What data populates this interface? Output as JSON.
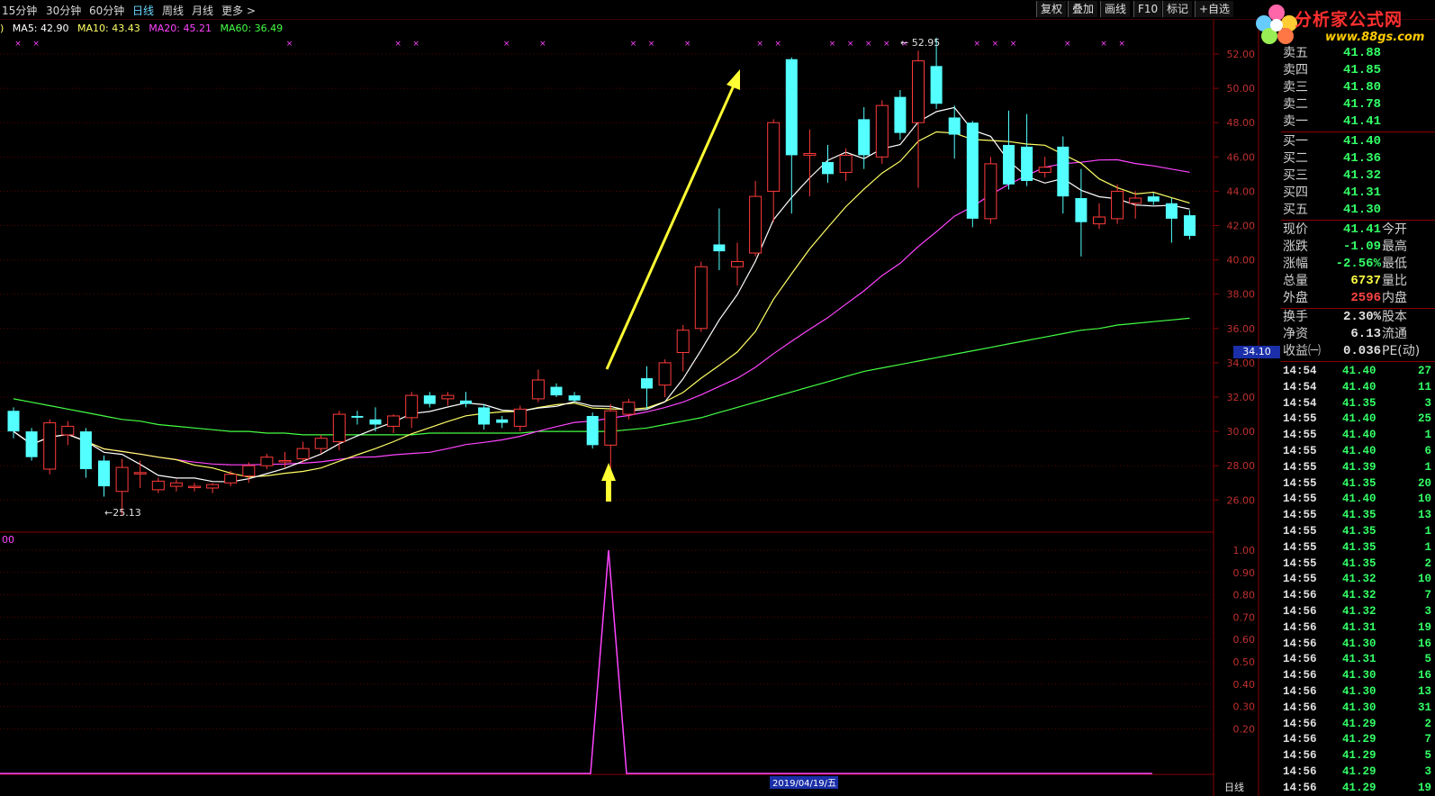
{
  "periods": [
    "15分钟",
    "30分钟",
    "60分钟",
    "日线",
    "周线",
    "月线",
    "更多 >"
  ],
  "active_period": "日线",
  "tools": [
    "复权",
    "叠加",
    "画线",
    "F10",
    "标记",
    "+自选"
  ],
  "logo": {
    "text": "分析家公式网",
    "url": "www.88gs.com"
  },
  "ma_legend": [
    {
      "label": "MA5: 42.90",
      "color": "#ffffff"
    },
    {
      "label": "MA10: 43.43",
      "color": "#ffff66"
    },
    {
      "label": "MA20: 45.21",
      "color": "#ff44ff"
    },
    {
      "label": "MA60: 36.49",
      "color": "#44ff44"
    }
  ],
  "price_axis": [
    "52.00",
    "50.00",
    "48.00",
    "46.00",
    "44.00",
    "42.00",
    "40.00",
    "38.00",
    "36.00",
    "34.00",
    "32.00",
    "30.00",
    "28.00",
    "26.00"
  ],
  "indicator_axis": [
    "1.00",
    "0.90",
    "0.80",
    "0.70",
    "0.60",
    "0.50",
    "0.40",
    "0.30",
    "0.20"
  ],
  "indicator_label": "00",
  "current_price_tag": "34.10",
  "high_label": "52.95",
  "low_label": "25.13",
  "bottom_date": "2019/04/19/五",
  "bottom_right_label": "日线",
  "quote": {
    "asks": [
      {
        "l": "卖五",
        "v": "41.88"
      },
      {
        "l": "卖四",
        "v": "41.85"
      },
      {
        "l": "卖三",
        "v": "41.80"
      },
      {
        "l": "卖二",
        "v": "41.78"
      },
      {
        "l": "卖一",
        "v": "41.41"
      }
    ],
    "bids": [
      {
        "l": "买一",
        "v": "41.40"
      },
      {
        "l": "买二",
        "v": "41.36"
      },
      {
        "l": "买三",
        "v": "41.32"
      },
      {
        "l": "买四",
        "v": "41.31"
      },
      {
        "l": "买五",
        "v": "41.30"
      }
    ],
    "stats": [
      {
        "l": "现价",
        "v": "41.41",
        "c": "#33ff66",
        "l2": "今开"
      },
      {
        "l": "涨跌",
        "v": "-1.09",
        "c": "#33ff66",
        "l2": "最高"
      },
      {
        "l": "涨幅",
        "v": "-2.56%",
        "c": "#33ff66",
        "l2": "最低"
      },
      {
        "l": "总量",
        "v": "6737",
        "c": "#ffff44",
        "l2": "量比"
      },
      {
        "l": "外盘",
        "v": "2596",
        "c": "#ff4444",
        "l2": "内盘"
      },
      {
        "l": "换手",
        "v": "2.30%",
        "c": "#e0e0e0",
        "l2": "股本"
      },
      {
        "l": "净资",
        "v": "6.13",
        "c": "#e0e0e0",
        "l2": "流通"
      },
      {
        "l": "收益㈠",
        "v": "0.036",
        "c": "#e0e0e0",
        "l2": "PE(动)"
      }
    ]
  },
  "ticks": [
    {
      "t": "14:54",
      "p": "41.40",
      "v": "27"
    },
    {
      "t": "14:54",
      "p": "41.40",
      "v": "11"
    },
    {
      "t": "14:54",
      "p": "41.35",
      "v": "3"
    },
    {
      "t": "14:55",
      "p": "41.40",
      "v": "25"
    },
    {
      "t": "14:55",
      "p": "41.40",
      "v": "1"
    },
    {
      "t": "14:55",
      "p": "41.40",
      "v": "6"
    },
    {
      "t": "14:55",
      "p": "41.39",
      "v": "1"
    },
    {
      "t": "14:55",
      "p": "41.35",
      "v": "20"
    },
    {
      "t": "14:55",
      "p": "41.40",
      "v": "10"
    },
    {
      "t": "14:55",
      "p": "41.35",
      "v": "13"
    },
    {
      "t": "14:55",
      "p": "41.35",
      "v": "1"
    },
    {
      "t": "14:55",
      "p": "41.35",
      "v": "1"
    },
    {
      "t": "14:55",
      "p": "41.35",
      "v": "2"
    },
    {
      "t": "14:55",
      "p": "41.32",
      "v": "10"
    },
    {
      "t": "14:56",
      "p": "41.32",
      "v": "7"
    },
    {
      "t": "14:56",
      "p": "41.32",
      "v": "3"
    },
    {
      "t": "14:56",
      "p": "41.31",
      "v": "19"
    },
    {
      "t": "14:56",
      "p": "41.30",
      "v": "16"
    },
    {
      "t": "14:56",
      "p": "41.31",
      "v": "5"
    },
    {
      "t": "14:56",
      "p": "41.30",
      "v": "16"
    },
    {
      "t": "14:56",
      "p": "41.30",
      "v": "13"
    },
    {
      "t": "14:56",
      "p": "41.30",
      "v": "31"
    },
    {
      "t": "14:56",
      "p": "41.29",
      "v": "2"
    },
    {
      "t": "14:56",
      "p": "41.29",
      "v": "7"
    },
    {
      "t": "14:56",
      "p": "41.29",
      "v": "5"
    },
    {
      "t": "14:56",
      "p": "41.29",
      "v": "3"
    },
    {
      "t": "14:56",
      "p": "41.29",
      "v": "19"
    }
  ],
  "candles": [
    [
      31.2,
      30.0,
      31.4,
      29.6
    ],
    [
      30.0,
      28.5,
      30.2,
      28.3
    ],
    [
      27.8,
      30.5,
      30.7,
      27.5
    ],
    [
      29.8,
      30.3,
      30.6,
      29.2
    ],
    [
      30.0,
      27.8,
      30.2,
      27.3
    ],
    [
      28.3,
      26.8,
      28.6,
      26.2
    ],
    [
      26.5,
      27.9,
      28.4,
      25.13
    ],
    [
      27.6,
      27.6,
      28.3,
      26.7
    ],
    [
      26.6,
      27.1,
      27.3,
      26.4
    ],
    [
      26.8,
      27.0,
      27.2,
      26.5
    ],
    [
      26.8,
      26.8,
      27.0,
      26.5
    ],
    [
      26.7,
      26.9,
      27.0,
      26.4
    ],
    [
      27.0,
      27.5,
      27.7,
      26.8
    ],
    [
      27.4,
      28.0,
      28.2,
      27.0
    ],
    [
      28.0,
      28.5,
      28.7,
      27.8
    ],
    [
      28.3,
      28.3,
      28.8,
      27.9
    ],
    [
      28.4,
      29.0,
      29.4,
      28.2
    ],
    [
      29.0,
      29.6,
      29.8,
      28.7
    ],
    [
      29.4,
      31.0,
      31.2,
      28.9
    ],
    [
      30.9,
      30.8,
      31.2,
      30.4
    ],
    [
      30.7,
      30.4,
      31.4,
      30.0
    ],
    [
      30.3,
      30.9,
      31.0,
      29.9
    ],
    [
      30.8,
      32.1,
      32.3,
      30.2
    ],
    [
      32.1,
      31.6,
      32.3,
      31.4
    ],
    [
      31.9,
      32.1,
      32.3,
      31.5
    ],
    [
      31.8,
      31.6,
      32.3,
      31.4
    ],
    [
      31.4,
      30.4,
      31.6,
      30.1
    ],
    [
      30.7,
      30.5,
      30.9,
      30.2
    ],
    [
      30.3,
      31.3,
      31.5,
      30.0
    ],
    [
      31.9,
      33.0,
      33.6,
      31.7
    ],
    [
      32.6,
      32.1,
      32.8,
      32.0
    ],
    [
      32.1,
      31.8,
      32.3,
      31.7
    ],
    [
      30.9,
      29.2,
      31.1,
      29.0
    ],
    [
      29.2,
      31.2,
      31.6,
      27.8
    ],
    [
      31.0,
      31.7,
      31.9,
      30.7
    ],
    [
      33.1,
      32.5,
      33.8,
      31.3
    ],
    [
      32.7,
      34.0,
      34.2,
      32.0
    ],
    [
      34.6,
      35.9,
      36.2,
      33.5
    ],
    [
      36.0,
      39.6,
      39.9,
      35.8
    ],
    [
      40.9,
      40.5,
      43.0,
      39.4
    ],
    [
      39.6,
      39.9,
      41.0,
      38.5
    ],
    [
      40.4,
      43.7,
      44.6,
      40.2
    ],
    [
      44.0,
      48.0,
      48.2,
      42.2
    ],
    [
      51.7,
      46.1,
      51.8,
      42.7
    ],
    [
      46.1,
      46.2,
      47.6,
      43.7
    ],
    [
      45.7,
      45.0,
      46.7,
      44.5
    ],
    [
      45.1,
      46.1,
      46.5,
      44.6
    ],
    [
      48.2,
      46.1,
      48.9,
      45.3
    ],
    [
      46.0,
      49.0,
      49.3,
      45.6
    ],
    [
      49.5,
      47.4,
      49.9,
      47.0
    ],
    [
      48.0,
      51.6,
      52.2,
      44.2
    ],
    [
      51.3,
      49.1,
      52.95,
      48.8
    ],
    [
      48.3,
      47.3,
      49.0,
      45.9
    ],
    [
      48.0,
      42.4,
      48.1,
      41.9
    ],
    [
      42.4,
      45.6,
      46.0,
      42.1
    ],
    [
      46.7,
      44.4,
      48.7,
      44.1
    ],
    [
      46.6,
      44.6,
      48.5,
      44.3
    ],
    [
      45.1,
      45.4,
      46.0,
      44.8
    ],
    [
      46.6,
      43.7,
      47.2,
      42.7
    ],
    [
      43.6,
      42.2,
      45.3,
      40.2
    ],
    [
      42.1,
      42.5,
      43.3,
      41.8
    ],
    [
      42.4,
      44.0,
      44.4,
      42.1
    ],
    [
      43.3,
      43.6,
      44.0,
      42.4
    ],
    [
      43.7,
      43.4,
      43.9,
      43.2
    ],
    [
      43.3,
      42.4,
      43.6,
      41.0
    ],
    [
      42.6,
      41.4,
      42.9,
      41.2
    ]
  ]
}
